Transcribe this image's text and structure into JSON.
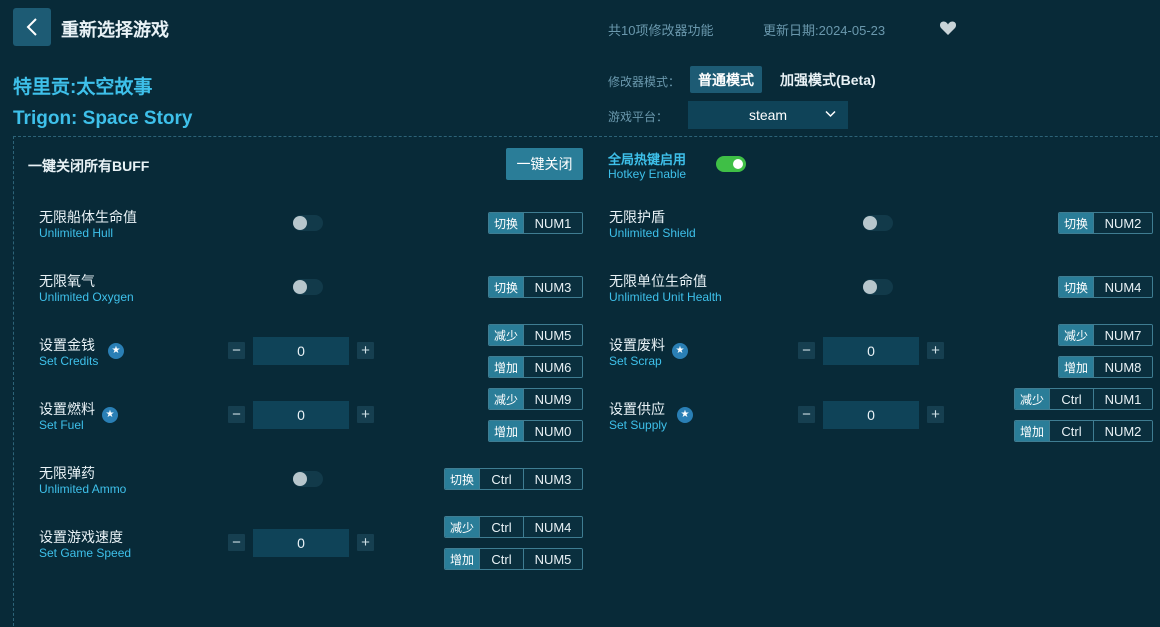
{
  "header": {
    "title": "重新选择游戏",
    "feature_count": "共10项修改器功能",
    "update_date": "更新日期:2024-05-23"
  },
  "game": {
    "name_cn": "特里贡:太空故事",
    "name_en": "Trigon: Space Story"
  },
  "mode": {
    "label": "修改器模式：",
    "normal": "普通模式",
    "beta": "加强模式(Beta)"
  },
  "platform": {
    "label": "游戏平台：",
    "value": "steam"
  },
  "buff": {
    "label": "一键关闭所有BUFF",
    "close_button": "一键关闭"
  },
  "hotkey": {
    "label_cn": "全局热键启用",
    "label_en": "Hotkey Enable",
    "enabled": true
  },
  "features": {
    "hull": {
      "cn": "无限船体生命值",
      "en": "Unlimited Hull",
      "action": "切换",
      "key": "NUM1"
    },
    "shield": {
      "cn": "无限护盾",
      "en": "Unlimited Shield",
      "action": "切换",
      "key": "NUM2"
    },
    "oxygen": {
      "cn": "无限氧气",
      "en": "Unlimited Oxygen",
      "action": "切换",
      "key": "NUM3"
    },
    "unit_health": {
      "cn": "无限单位生命值",
      "en": "Unlimited Unit Health",
      "action": "切换",
      "key": "NUM4"
    },
    "credits": {
      "cn": "设置金钱",
      "en": "Set Credits",
      "value": "0",
      "dec": "减少",
      "dec_key": "NUM5",
      "inc": "增加",
      "inc_key": "NUM6"
    },
    "scrap": {
      "cn": "设置废料",
      "en": "Set Scrap",
      "value": "0",
      "dec": "减少",
      "dec_key": "NUM7",
      "inc": "增加",
      "inc_key": "NUM8"
    },
    "fuel": {
      "cn": "设置燃料",
      "en": "Set Fuel",
      "value": "0",
      "dec": "减少",
      "dec_key": "NUM9",
      "inc": "增加",
      "inc_key": "NUM0"
    },
    "supply": {
      "cn": "设置供应",
      "en": "Set Supply",
      "value": "0",
      "dec": "减少",
      "dec_mod": "Ctrl",
      "dec_key": "NUM1",
      "inc": "增加",
      "inc_mod": "Ctrl",
      "inc_key": "NUM2"
    },
    "ammo": {
      "cn": "无限弹药",
      "en": "Unlimited Ammo",
      "action": "切换",
      "mod": "Ctrl",
      "key": "NUM3"
    },
    "speed": {
      "cn": "设置游戏速度",
      "en": "Set Game Speed",
      "value": "0",
      "dec": "减少",
      "dec_mod": "Ctrl",
      "dec_key": "NUM4",
      "inc": "增加",
      "inc_mod": "Ctrl",
      "inc_key": "NUM5"
    }
  },
  "icons": {
    "back": "chevron-left-icon",
    "favorite": "heart-icon",
    "dropdown": "chevron-down-icon",
    "star": "star-icon",
    "minus": "−",
    "plus": "+"
  },
  "colors": {
    "background": "#082a38",
    "accent": "#3ec0ea",
    "button": "#1d5b74",
    "toggle_on": "#3fbf46"
  }
}
